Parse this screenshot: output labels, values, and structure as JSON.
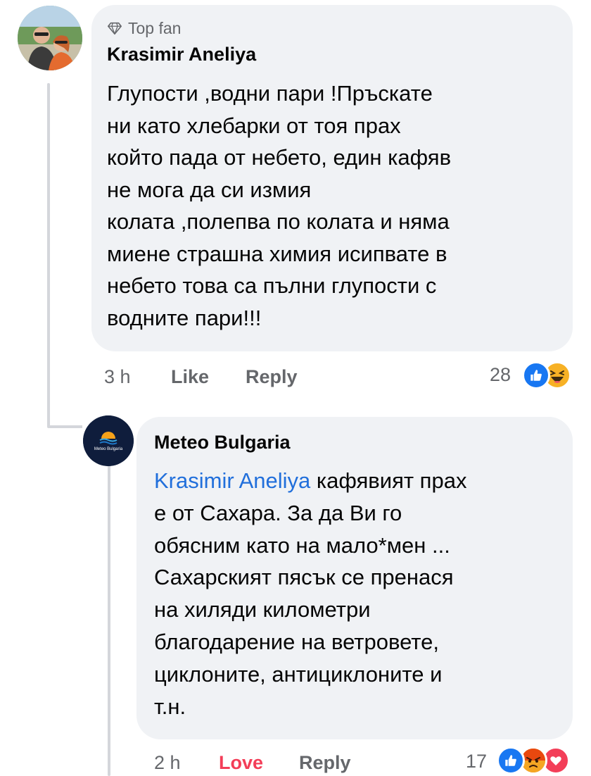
{
  "comments": [
    {
      "badge": "Top fan",
      "author": "Krasimir Aneliya",
      "text": "Глупости ,водни пари !Пръскате\nни като хлебарки от тоя прах\nкойто пада от небето, един кафяв\nне мога да си измия\nколата ,полепва по колата и няма\nмиене страшна химия исипвате в\nнебето това са пълни глупости с\nводните пари!!!",
      "time": "3 h",
      "like_label": "Like",
      "reply_label": "Reply",
      "reaction_count": "28",
      "reactions": [
        "like-icon",
        "haha-icon"
      ]
    }
  ],
  "reply": {
    "author": "Meteo Bulgaria",
    "mention": "Krasimir Aneliya",
    "text_lines": [
      " кафявият прах",
      "е от Сахара. За да Ви го",
      "обясним като на мало*мен ...",
      "Сахарският пясък се пренася",
      "на хиляди километри",
      "благодарение на ветровете,",
      "циклоните, антициклоните и",
      "т.н."
    ],
    "avatar_text": "Meteo Bulgaria",
    "time": "2 h",
    "love_label": "Love",
    "reply_label": "Reply",
    "reaction_count": "17",
    "reactions": [
      "like-icon",
      "angry-icon",
      "love-icon"
    ]
  },
  "colors": {
    "bubble": "#f0f2f5",
    "mention": "#216fdb",
    "love": "#f33e58",
    "like": "#1877f2",
    "secondary_text": "#65676b"
  }
}
